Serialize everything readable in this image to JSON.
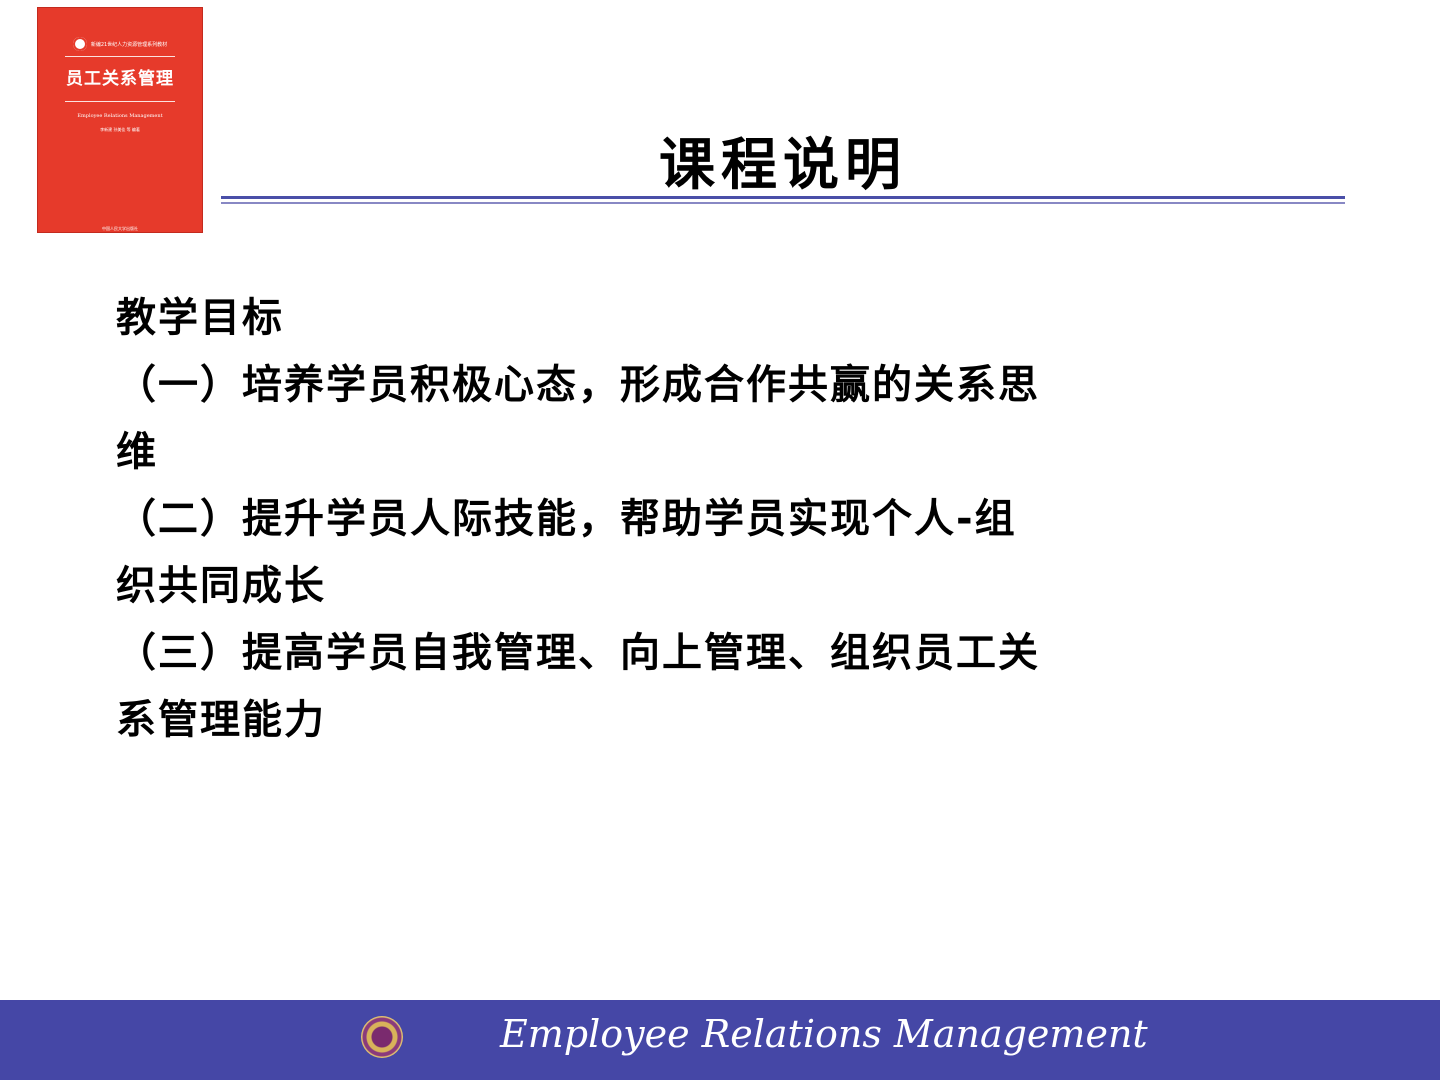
{
  "book_cover": {
    "series": "新编21世纪人力资源管理系列教材",
    "title": "员工关系管理",
    "subtitle": "Employee Relations Management",
    "authors": "李新建 孙美佳 等 编著",
    "publisher": "中国人民大学出版社",
    "color": "#e63a2b"
  },
  "slide": {
    "title": "课程说明",
    "body_lines": [
      "教学目标",
      "（一）培养学员积极心态，形成合作共赢的关系思",
      "维",
      "（二）提升学员人际技能，帮助学员实现个人-组",
      "织共同成长",
      "（三）提高学员自我管理、向上管理、组织员工关",
      "系管理能力"
    ]
  },
  "footer": {
    "text": "Employee Relations Management",
    "logo_icon": "university-seal-icon",
    "color": "#4547a6"
  }
}
